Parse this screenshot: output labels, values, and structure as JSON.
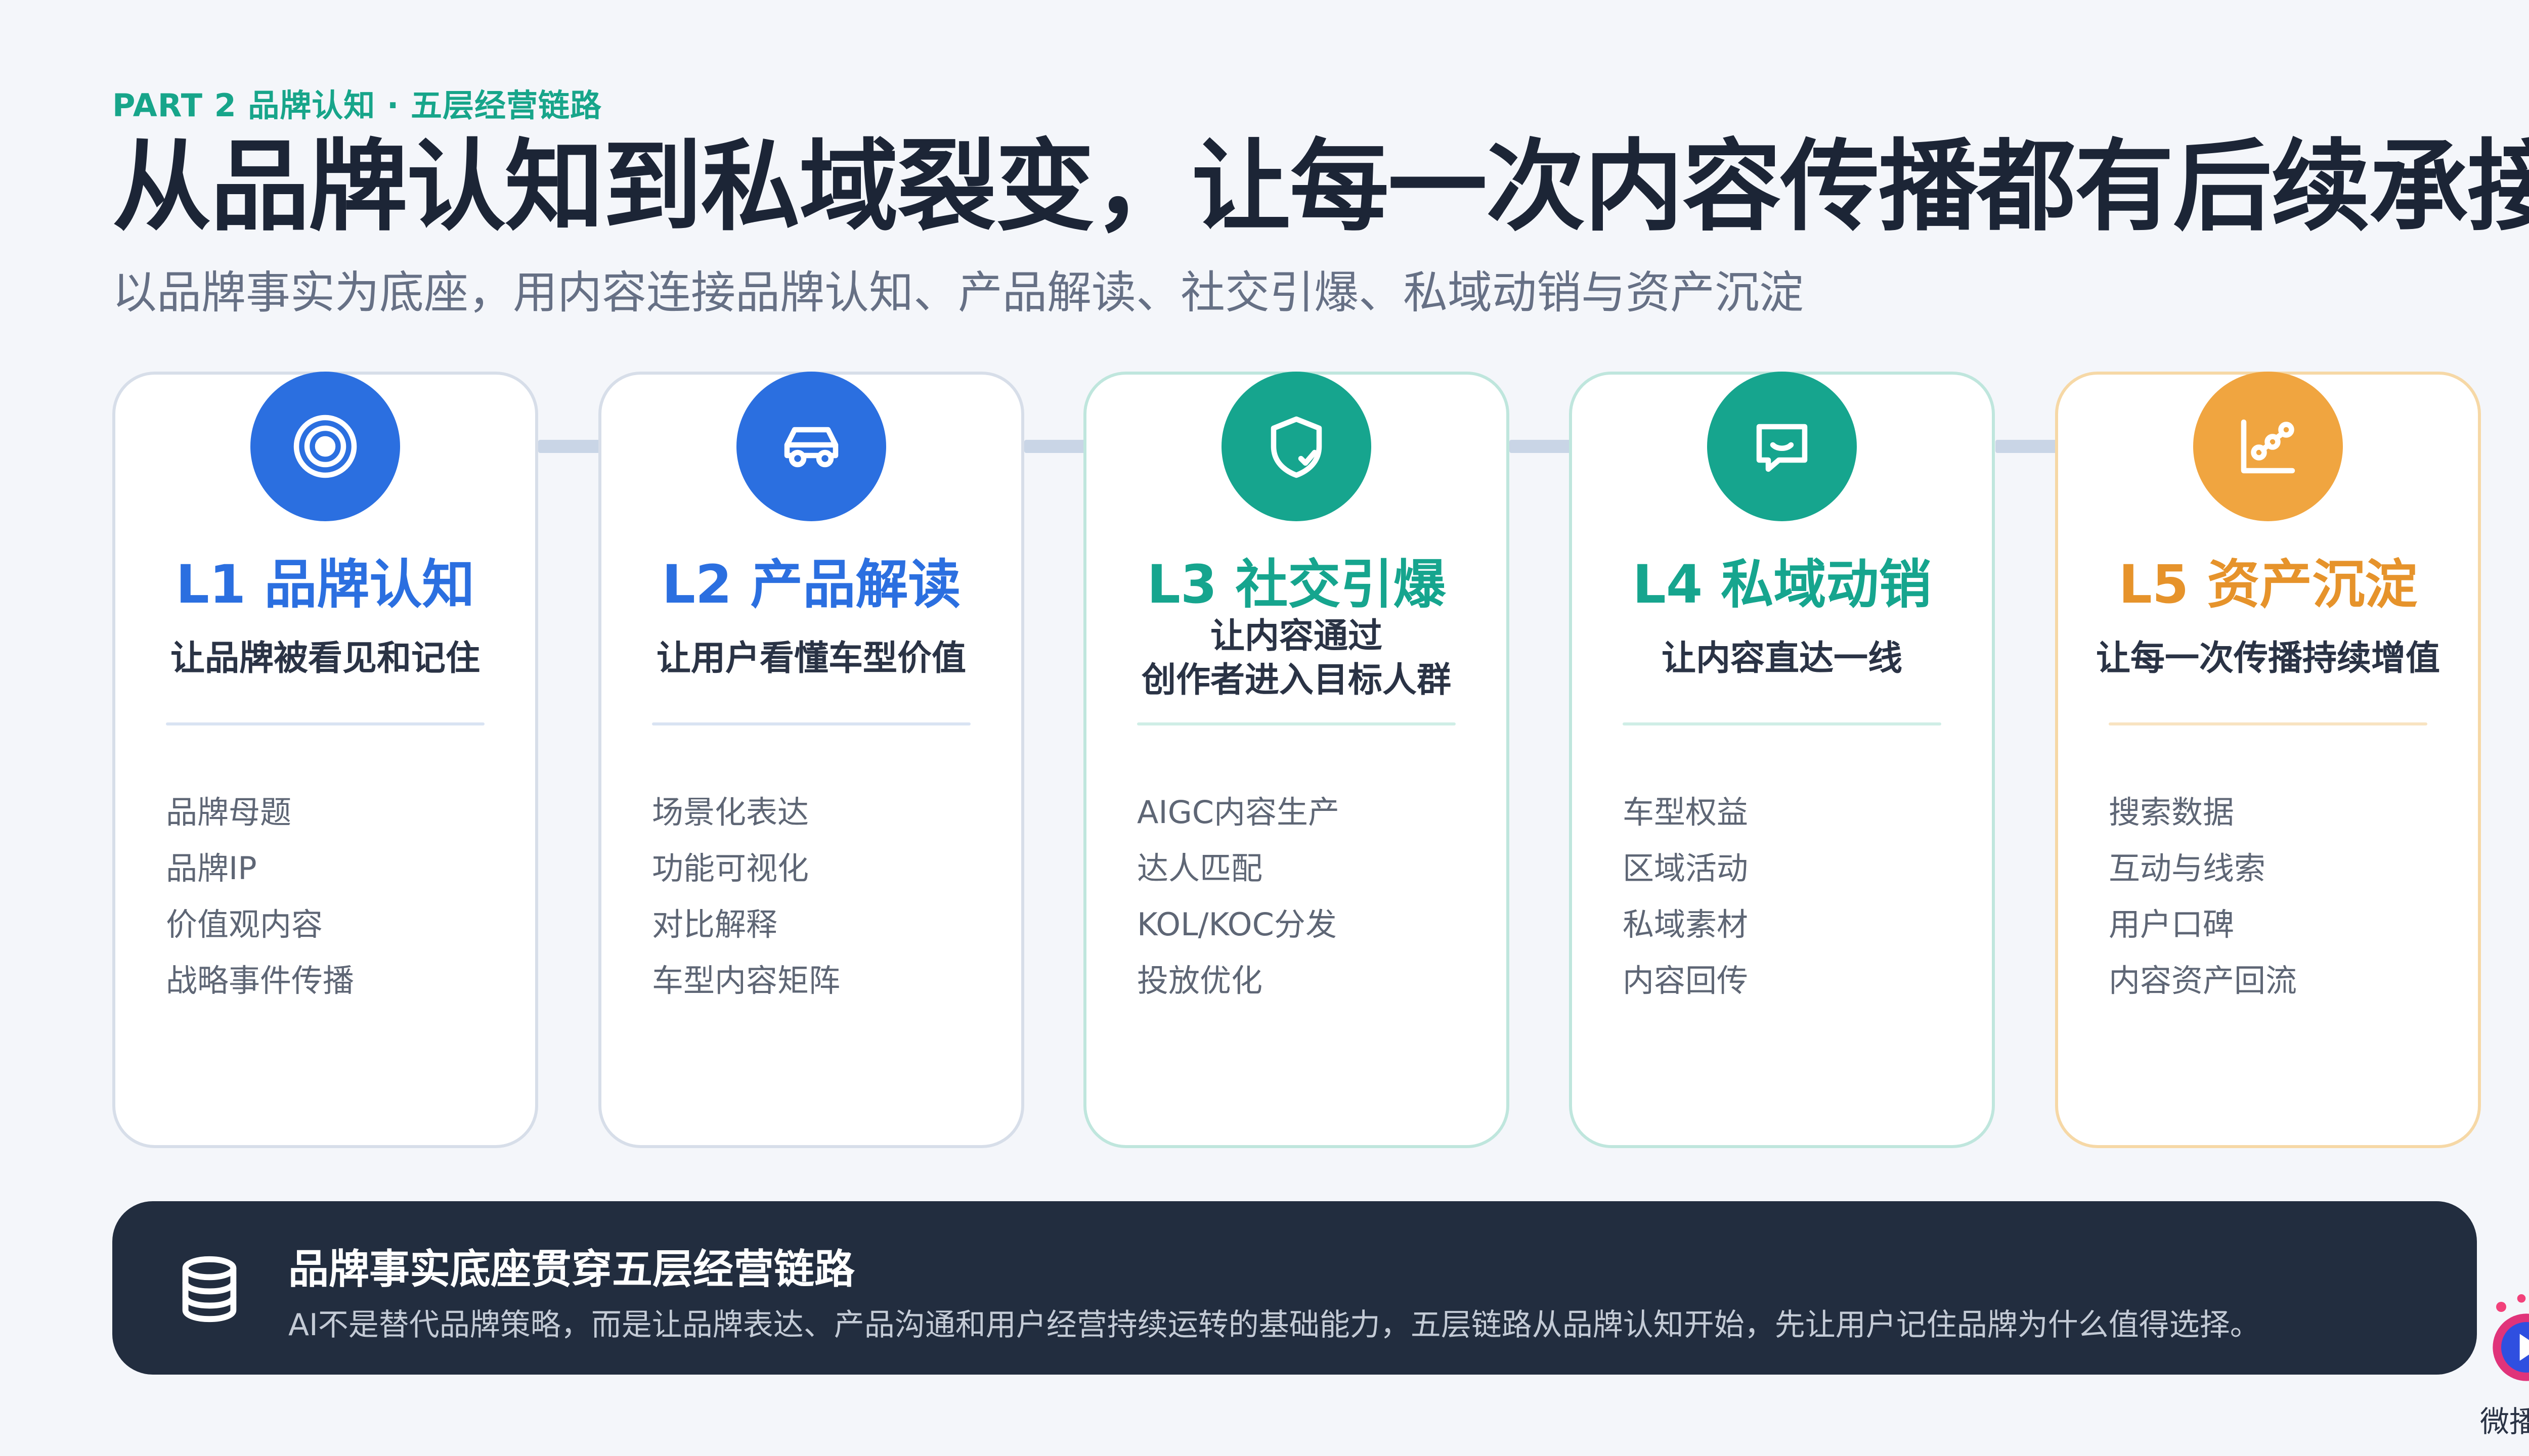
{
  "header": {
    "kicker": "PART 2 品牌认知 · 五层经营链路",
    "title": "从品牌认知到私域裂变，让每一次内容传播都有后续承接",
    "subtitle": "以品牌事实为底座，用内容连接品牌认知、产品解读、社交引爆、私域动销与资产沉淀"
  },
  "colors": {
    "blue": "#2b6fe0",
    "teal": "#16a58e",
    "orange": "#f0a540",
    "dark": "#222d3f"
  },
  "cards": [
    {
      "level": "L1 品牌认知",
      "tagline": "让品牌被看见和记住",
      "icon": "target-icon",
      "items": [
        "品牌母题",
        "品牌IP",
        "价值观内容",
        "战略事件传播"
      ]
    },
    {
      "level": "L2 产品解读",
      "tagline": "让用户看懂车型价值",
      "icon": "car-icon",
      "items": [
        "场景化表达",
        "功能可视化",
        "对比解释",
        "车型内容矩阵"
      ]
    },
    {
      "level": "L3 社交引爆",
      "tagline_lines": [
        "让内容通过",
        "创作者进入目标人群"
      ],
      "icon": "shield-check-icon",
      "items": [
        "AIGC内容生产",
        "达人匹配",
        "KOL/KOC分发",
        "投放优化"
      ]
    },
    {
      "level": "L4 私域动销",
      "tagline": "让内容直达一线",
      "icon": "chat-icon",
      "items": [
        "车型权益",
        "区域活动",
        "私域素材",
        "内容回传"
      ]
    },
    {
      "level": "L5 资产沉淀",
      "tagline": "让每一次传播持续增值",
      "icon": "chart-network-icon",
      "items": [
        "搜索数据",
        "互动与线索",
        "用户口碑",
        "内容资产回流"
      ]
    }
  ],
  "banner": {
    "icon": "database-icon",
    "title": "品牌事实底座贯穿五层经营链路",
    "text": "AI不是替代品牌策略，而是让品牌表达、产品沟通和用户经营持续运转的基础能力，五层链路从品牌认知开始，先让用户记住品牌为什么值得选择。"
  },
  "logo": {
    "text": "微播易",
    "icon": "play-logo-icon"
  }
}
